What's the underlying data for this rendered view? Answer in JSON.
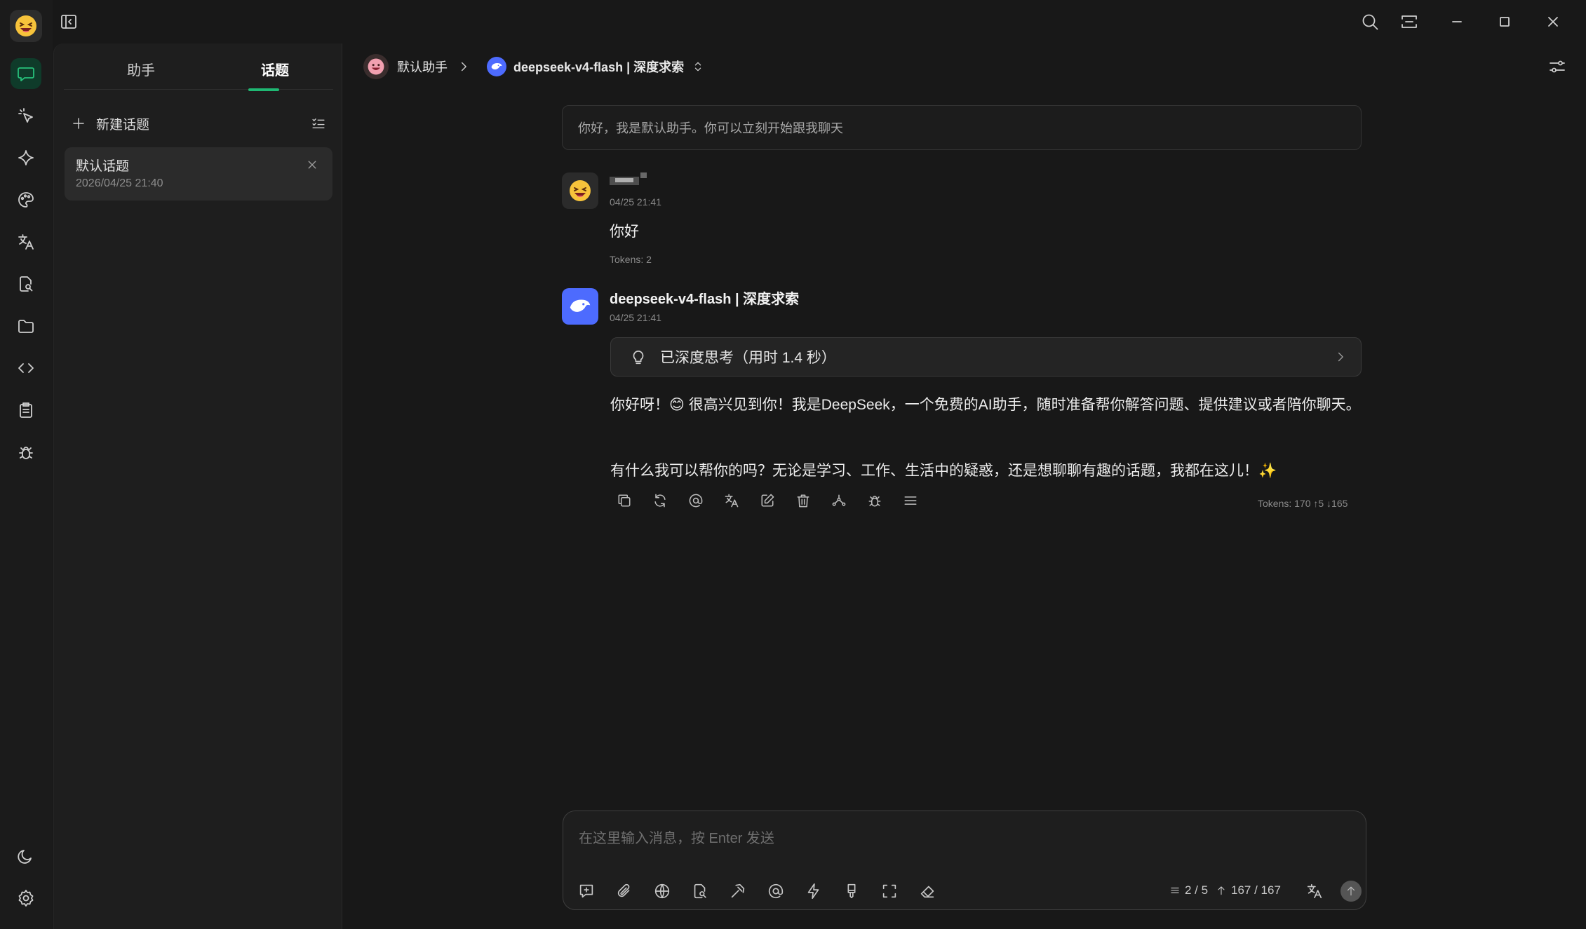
{
  "app": {
    "accent": "#1fb873"
  },
  "nav": {
    "items": [
      "chat-icon",
      "cursor-sparkle-icon",
      "sparkle-icon",
      "palette-icon",
      "translate-icon",
      "document-search-icon",
      "folder-icon",
      "code-icon",
      "clipboard-icon",
      "bug-icon"
    ],
    "bottom": [
      "moon-icon",
      "gear-icon"
    ]
  },
  "panel": {
    "tabs": [
      {
        "label": "助手"
      },
      {
        "label": "话题"
      }
    ],
    "active_tab": 1,
    "new_topic_label": "新建话题",
    "topics": [
      {
        "title": "默认话题",
        "time": "2026/04/25 21:40"
      }
    ]
  },
  "header": {
    "assistant": "默认助手",
    "model": "deepseek-v4-flash | 深度求索"
  },
  "chat": {
    "system_message": "你好，我是默认助手。你可以立刻开始跟我聊天",
    "user_message": {
      "name": "",
      "time": "04/25 21:41",
      "text": "你好",
      "tokens": "Tokens: 2"
    },
    "assistant_message": {
      "name": "deepseek-v4-flash | 深度求索",
      "time": "04/25 21:41",
      "thinking": "已深度思考（用时 1.4 秒）",
      "paragraph_1": "你好呀！😊 很高兴见到你！我是DeepSeek，一个免费的AI助手，随时准备帮你解答问题、提供建议或者陪你聊天。",
      "paragraph_2": "有什么我可以帮你的吗？无论是学习、工作、生活中的疑惑，还是想聊聊有趣的话题，我都在这儿！✨",
      "tokens": "Tokens: 170 ↑5 ↓165"
    }
  },
  "input": {
    "placeholder": "在这里输入消息，按 Enter 发送",
    "context_count": "2 / 5",
    "token_count": "167 / 167"
  }
}
